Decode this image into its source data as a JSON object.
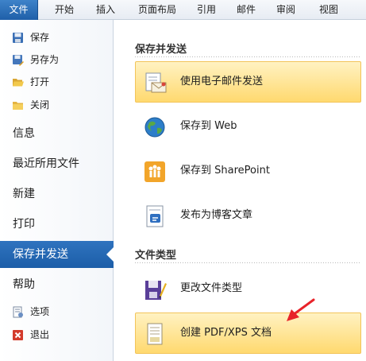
{
  "ribbon": {
    "tabs": [
      "文件",
      "开始",
      "插入",
      "页面布局",
      "引用",
      "邮件",
      "审阅",
      "视图"
    ]
  },
  "nav": {
    "commands_top": [
      "保存",
      "另存为",
      "打开",
      "关闭"
    ],
    "items": [
      "信息",
      "最近所用文件",
      "新建",
      "打印",
      "保存并发送",
      "帮助"
    ],
    "active": "保存并发送",
    "commands_bottom": [
      "选项",
      "退出"
    ]
  },
  "pane": {
    "section1_title": "保存并发送",
    "section1_options": [
      "使用电子邮件发送",
      "保存到 Web",
      "保存到 SharePoint",
      "发布为博客文章"
    ],
    "section2_title": "文件类型",
    "section2_options": [
      "更改文件类型",
      "创建 PDF/XPS 文档"
    ]
  },
  "colors": {
    "active_nav": "#1f5fa9",
    "highlight": "#ffd96f",
    "annotation_arrow": "#e8232a"
  },
  "icons": {
    "save": "floppy-disk-icon",
    "save_as": "save-as-icon",
    "open": "folder-open-icon",
    "close": "folder-close-icon",
    "options": "document-options-icon",
    "exit": "exit-x-icon",
    "email": "email-envelope-icon",
    "web": "globe-icon",
    "sharepoint": "sharepoint-icon",
    "blog": "blog-post-icon",
    "change_type": "change-file-type-icon",
    "pdf": "pdf-document-icon"
  }
}
